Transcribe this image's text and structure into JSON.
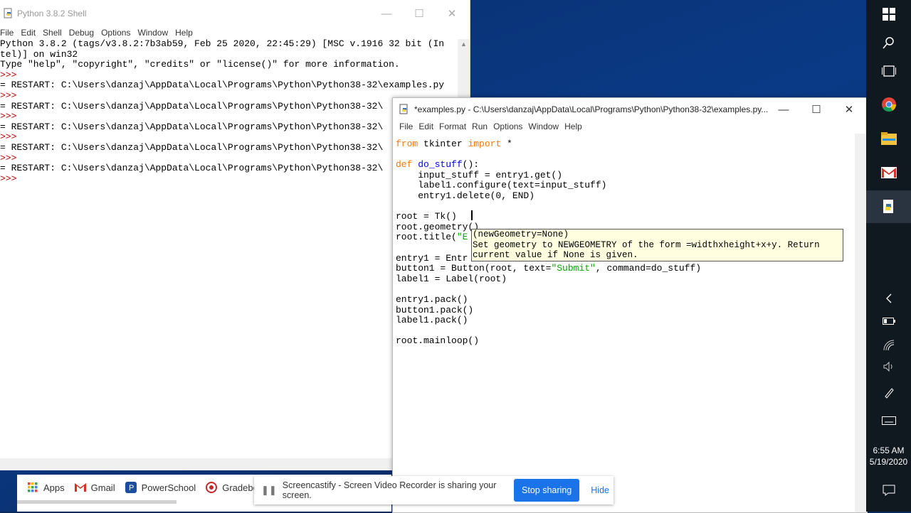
{
  "shell": {
    "title": "Python 3.8.2 Shell",
    "menu": [
      "File",
      "Edit",
      "Shell",
      "Debug",
      "Options",
      "Window",
      "Help"
    ],
    "lines": [
      {
        "prompt": "",
        "text": "Python 3.8.2 (tags/v3.8.2:7b3ab59, Feb 25 2020, 22:45:29) [MSC v.1916 32 bit (In"
      },
      {
        "prompt": "",
        "text": "tel)] on win32"
      },
      {
        "prompt": "",
        "text": "Type \"help\", \"copyright\", \"credits\" or \"license()\" for more information."
      },
      {
        "prompt": ">>> ",
        "text": ""
      },
      {
        "prompt": "",
        "text": "= RESTART: C:\\Users\\danzaj\\AppData\\Local\\Programs\\Python\\Python38-32\\examples.py"
      },
      {
        "prompt": ">>> ",
        "text": ""
      },
      {
        "prompt": "",
        "text": "= RESTART: C:\\Users\\danzaj\\AppData\\Local\\Programs\\Python\\Python38-32\\"
      },
      {
        "prompt": ">>> ",
        "text": ""
      },
      {
        "prompt": "",
        "text": "= RESTART: C:\\Users\\danzaj\\AppData\\Local\\Programs\\Python\\Python38-32\\"
      },
      {
        "prompt": ">>> ",
        "text": ""
      },
      {
        "prompt": "",
        "text": "= RESTART: C:\\Users\\danzaj\\AppData\\Local\\Programs\\Python\\Python38-32\\"
      },
      {
        "prompt": ">>> ",
        "text": ""
      },
      {
        "prompt": "",
        "text": "= RESTART: C:\\Users\\danzaj\\AppData\\Local\\Programs\\Python\\Python38-32\\"
      },
      {
        "prompt": ">>> ",
        "text": ""
      }
    ]
  },
  "editor": {
    "title": "*examples.py - C:\\Users\\danzaj\\AppData\\Local\\Programs\\Python\\Python38-32\\examples.py...",
    "menu": [
      "File",
      "Edit",
      "Format",
      "Run",
      "Options",
      "Window",
      "Help"
    ],
    "code": [
      [
        {
          "t": "from",
          "c": "kw"
        },
        {
          "t": " tkinter ",
          "c": ""
        },
        {
          "t": "import",
          "c": "kw"
        },
        {
          "t": " *",
          "c": ""
        }
      ],
      [],
      [
        {
          "t": "def",
          "c": "kw"
        },
        {
          "t": " ",
          "c": ""
        },
        {
          "t": "do_stuff",
          "c": "fn"
        },
        {
          "t": "():",
          "c": ""
        }
      ],
      [
        {
          "t": "    input_stuff = entry1.get()",
          "c": ""
        }
      ],
      [
        {
          "t": "    label1.configure(text=input_stuff)",
          "c": ""
        }
      ],
      [
        {
          "t": "    entry1.delete(0, END)",
          "c": ""
        }
      ],
      [],
      [
        {
          "t": "root = Tk()",
          "c": ""
        }
      ],
      [
        {
          "t": "root.geometry()",
          "c": ""
        }
      ],
      [
        {
          "t": "root.title(",
          "c": ""
        },
        {
          "t": "\"E",
          "c": "st"
        }
      ],
      [],
      [
        {
          "t": "entry1 = Entr",
          "c": ""
        }
      ],
      [
        {
          "t": "button1 = Button(root, text=",
          "c": ""
        },
        {
          "t": "\"Submit\"",
          "c": "st"
        },
        {
          "t": ", command=do_stuff)",
          "c": ""
        }
      ],
      [
        {
          "t": "label1 = Label(root)",
          "c": ""
        }
      ],
      [],
      [
        {
          "t": "entry1.pack()",
          "c": ""
        }
      ],
      [
        {
          "t": "button1.pack()",
          "c": ""
        }
      ],
      [
        {
          "t": "label1.pack()",
          "c": ""
        }
      ],
      [],
      [
        {
          "t": "root.mainloop()",
          "c": ""
        }
      ]
    ],
    "tooltip": [
      "(newGeometry=None)",
      "Set geometry to NEWGEOMETRY of the form =widthxheight+x+y. Return",
      "current value if None is given."
    ]
  },
  "bookmarks": [
    {
      "label": "Apps",
      "icon": "apps-grid-icon"
    },
    {
      "label": "Gmail",
      "icon": "gmail-icon"
    },
    {
      "label": "PowerSchool",
      "icon": "powerschool-icon"
    },
    {
      "label": "Gradebo",
      "icon": "gradebook-icon"
    }
  ],
  "castbar": {
    "message": "Screencastify - Screen Video Recorder is sharing your screen.",
    "stop_label": "Stop sharing",
    "hide_label": "Hide"
  },
  "clock": {
    "time": "6:55 AM",
    "date": "5/19/2020"
  },
  "colors": {
    "keyword": "#ff7700",
    "function": "#0000ff",
    "string": "#00aa00",
    "prompt": "#c00000",
    "accent": "#1a73e8"
  }
}
